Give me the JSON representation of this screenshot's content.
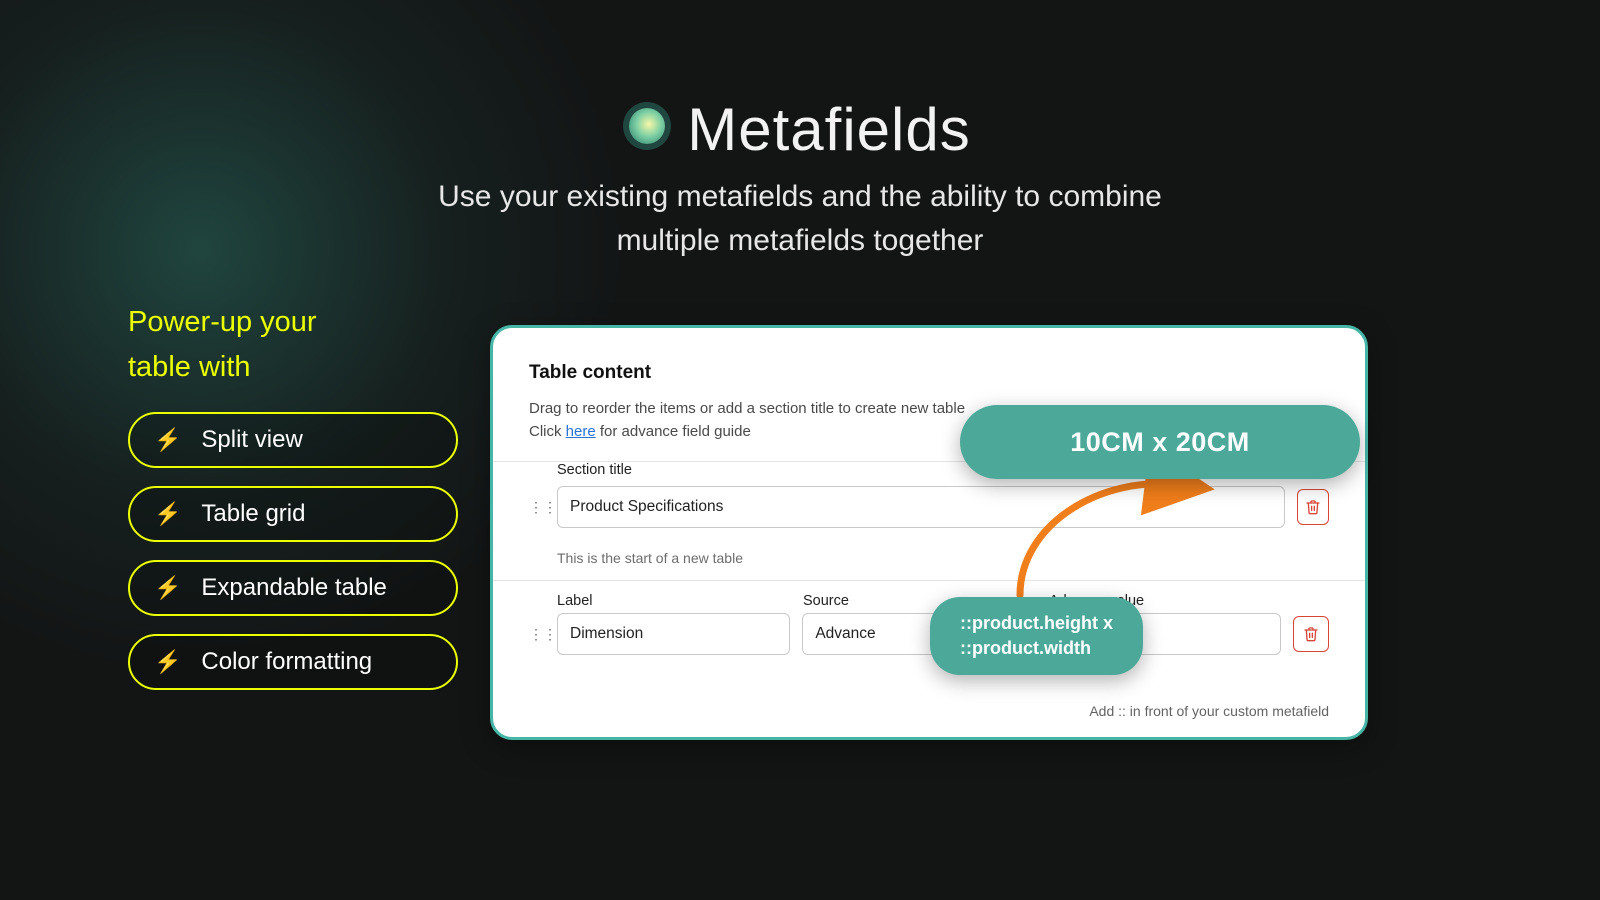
{
  "header": {
    "title": "Metafields",
    "subtitle_line1": "Use your existing metafields and the ability to combine",
    "subtitle_line2": "multiple metafields together"
  },
  "sidebar": {
    "heading_line1": "Power-up your",
    "heading_line2": "table with",
    "items": [
      {
        "label": "Split view"
      },
      {
        "label": "Table grid"
      },
      {
        "label": "Expandable table"
      },
      {
        "label": "Color formatting"
      }
    ]
  },
  "panel": {
    "title": "Table content",
    "desc_line1": "Drag to reorder the items or add a section title to create new table",
    "desc_prefix": "Click ",
    "desc_link": "here",
    "desc_suffix": " for advance field guide",
    "section_title_label": "Section title",
    "section_title_value": "Product Specifications",
    "section_title_sub": "This is the start of a new table",
    "col_label_header": "Label",
    "col_source_header": "Source",
    "col_advance_header": "Advance value",
    "row_label_value": "Dimension",
    "row_source_value": "Advance",
    "row_advance_value": "",
    "footnote": "Add :: in front of your custom metafield"
  },
  "callouts": {
    "result": "10CM x 20CM",
    "formula_line1": "::product.height x",
    "formula_line2": "::product.width"
  }
}
